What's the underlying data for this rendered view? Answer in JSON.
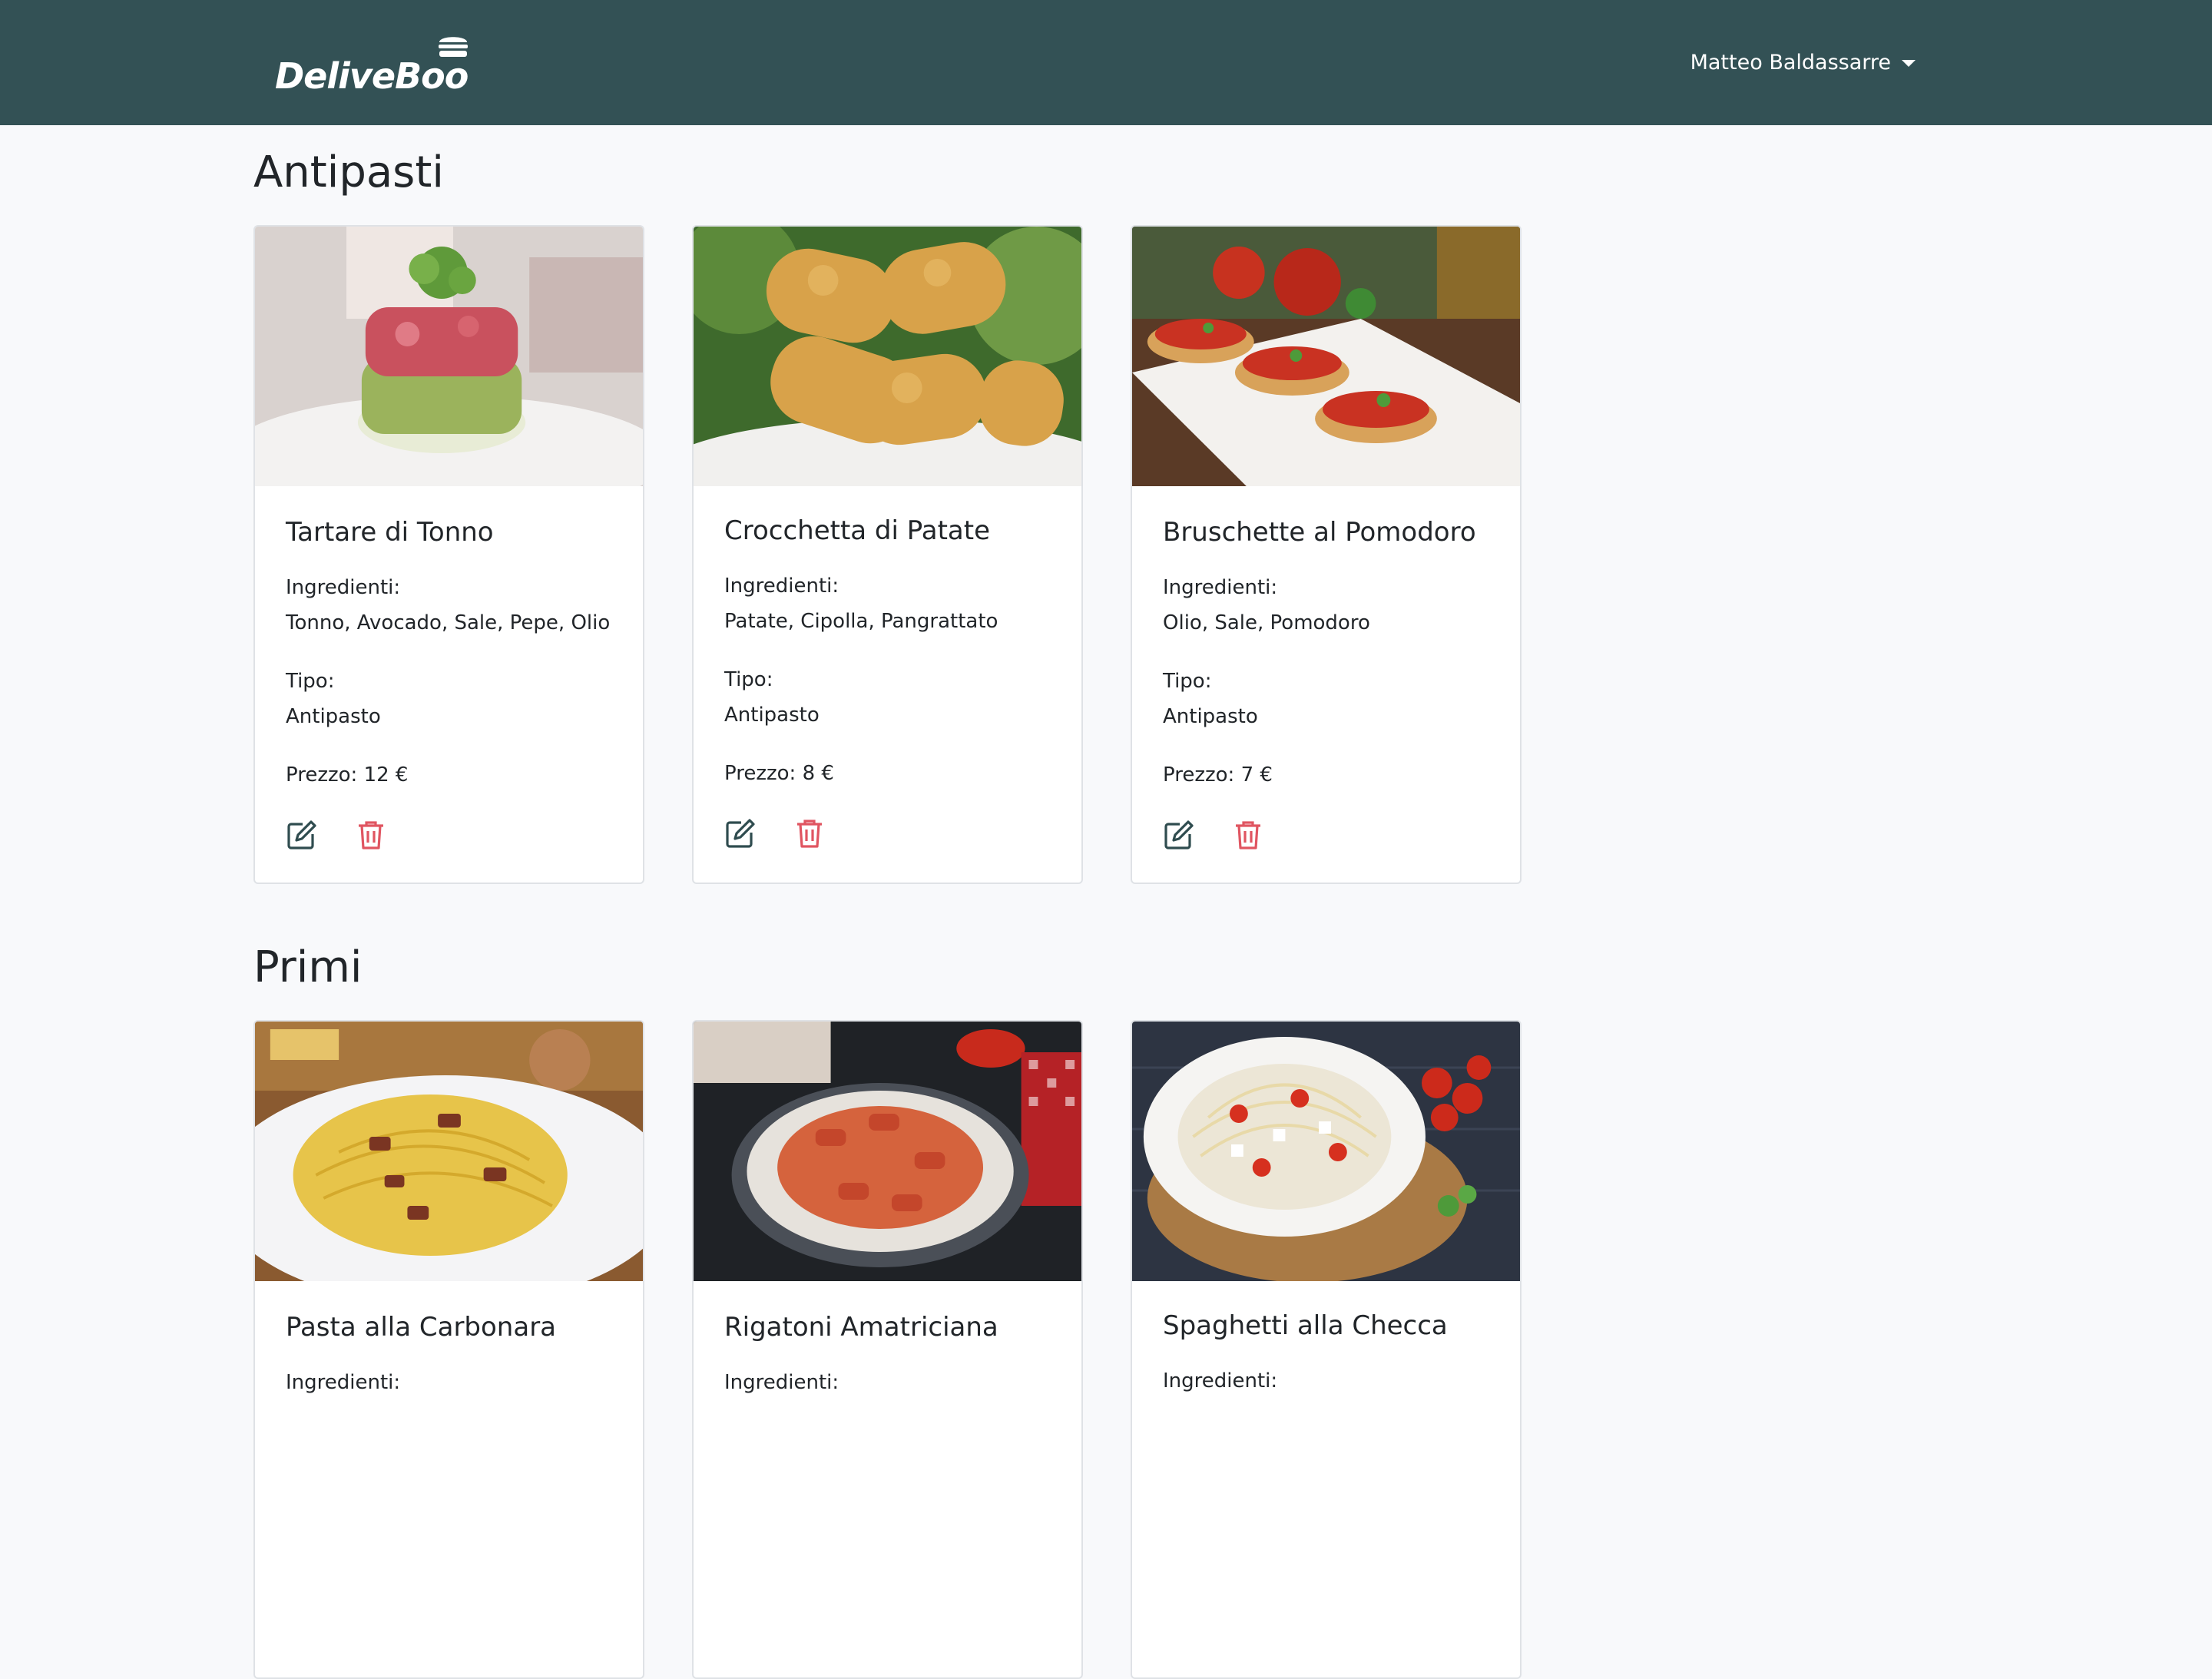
{
  "navbar": {
    "brand": "DeliveBoo",
    "user_name": "Matteo Baldassarre"
  },
  "colors": {
    "navbar_bg": "#335155",
    "page_bg": "#f8f9fb",
    "edit_icon": "#2f4c4f",
    "delete_icon": "#e05561"
  },
  "sections": [
    {
      "title": "Antipasti",
      "dishes": [
        {
          "name": "Tartare di Tonno",
          "ingredients_label": "Ingredienti:",
          "ingredients": "Tonno, Avocado, Sale, Pepe, Olio",
          "type_label": "Tipo:",
          "type": "Antipasto",
          "price": "Prezzo: 12 €",
          "image_icon": "tuna-tartare-photo"
        },
        {
          "name": "Crocchetta di Patate",
          "ingredients_label": "Ingredienti:",
          "ingredients": "Patate, Cipolla, Pangrattato",
          "type_label": "Tipo:",
          "type": "Antipasto",
          "price": "Prezzo: 8 €",
          "image_icon": "potato-croquettes-photo"
        },
        {
          "name": "Bruschette al Pomodoro",
          "ingredients_label": "Ingredienti:",
          "ingredients": "Olio, Sale, Pomodoro",
          "type_label": "Tipo:",
          "type": "Antipasto",
          "price": "Prezzo: 7 €",
          "image_icon": "bruschetta-photo"
        }
      ]
    },
    {
      "title": "Primi",
      "dishes": [
        {
          "name": "Pasta alla Carbonara",
          "ingredients_label": "Ingredienti:",
          "image_icon": "carbonara-photo"
        },
        {
          "name": "Rigatoni Amatriciana",
          "ingredients_label": "Ingredienti:",
          "image_icon": "amatriciana-photo"
        },
        {
          "name": "Spaghetti alla Checca",
          "ingredients_label": "Ingredienti:",
          "image_icon": "checca-photo"
        }
      ]
    }
  ]
}
